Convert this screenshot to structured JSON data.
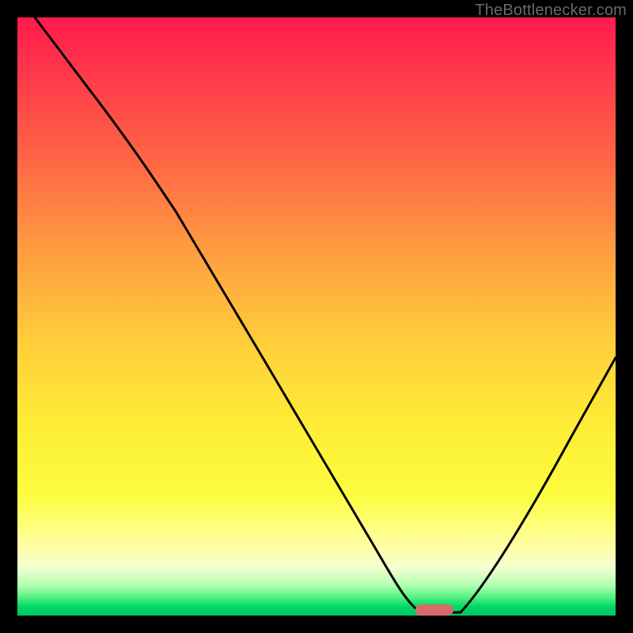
{
  "watermark": {
    "text": "TheBottlenecker.com"
  },
  "chart_data": {
    "type": "line",
    "title": "",
    "xlabel": "",
    "ylabel": "",
    "xlim": [
      0,
      100
    ],
    "ylim": [
      0,
      100
    ],
    "grid": false,
    "legend": false,
    "series": [
      {
        "name": "bottleneck-curve",
        "x": [
          3,
          12,
          22,
          32,
          42,
          52,
          60,
          65,
          69,
          72,
          75,
          82,
          90,
          100
        ],
        "values": [
          100,
          88,
          75,
          60,
          45,
          30,
          16,
          7,
          2,
          0,
          0,
          12,
          28,
          50
        ]
      }
    ],
    "marker": {
      "x_start": 69,
      "x_end": 76,
      "y": 0,
      "color": "#d96a6a",
      "shape": "pill"
    },
    "background_gradient": {
      "top": "#ff1a4d",
      "mid": "#ffd03a",
      "bottom": "#00c860"
    }
  }
}
